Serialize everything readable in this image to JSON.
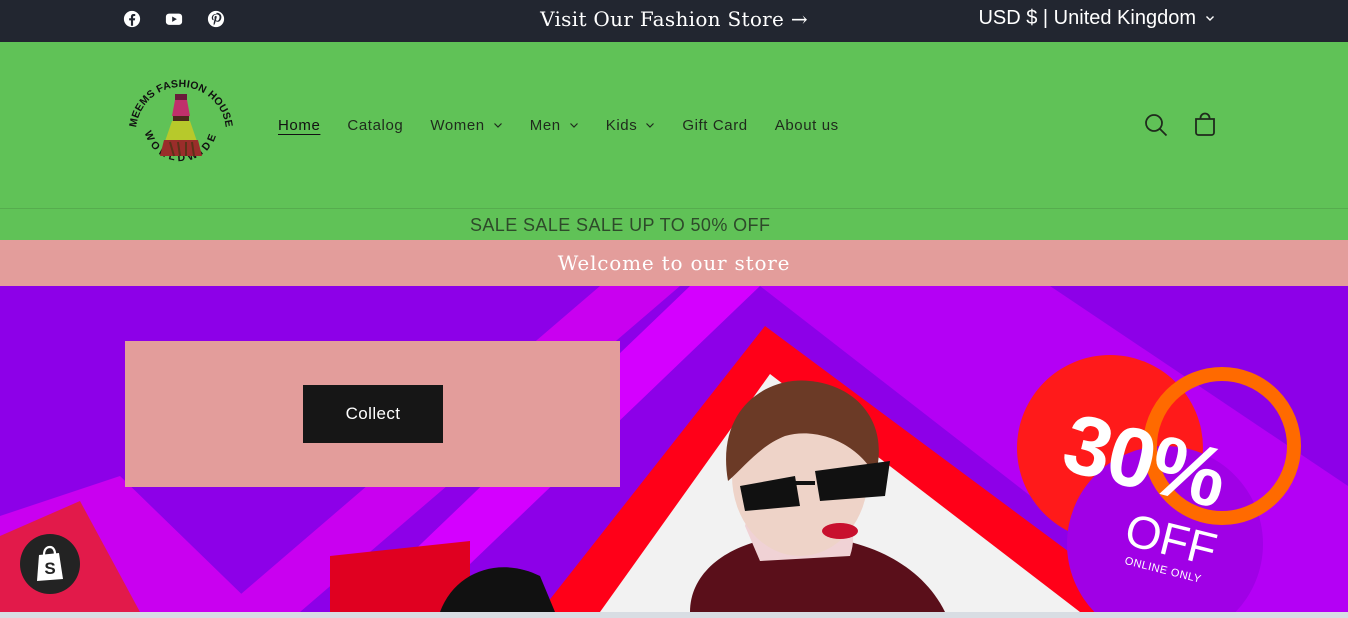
{
  "topbar": {
    "social": [
      {
        "name": "facebook-icon"
      },
      {
        "name": "youtube-icon"
      },
      {
        "name": "pinterest-icon"
      }
    ],
    "announcement": "Visit Our Fashion Store",
    "announcement_arrow": "→",
    "locale": "USD $ | United Kingdom"
  },
  "header": {
    "logo": {
      "arc_top": "MEEMS FASHION HOUSE",
      "arc_bottom": "WORLDWIDE"
    },
    "nav": [
      {
        "label": "Home",
        "active": true,
        "dropdown": false
      },
      {
        "label": "Catalog",
        "active": false,
        "dropdown": false
      },
      {
        "label": "Women",
        "active": false,
        "dropdown": true
      },
      {
        "label": "Men",
        "active": false,
        "dropdown": true
      },
      {
        "label": "Kids",
        "active": false,
        "dropdown": true
      },
      {
        "label": "Gift Card",
        "active": false,
        "dropdown": false
      },
      {
        "label": "About us",
        "active": false,
        "dropdown": false
      }
    ],
    "icons": [
      "search-icon",
      "cart-icon"
    ]
  },
  "sale_banner": "SALE SALE SALE UP TO 50% OFF",
  "welcome_banner": "Welcome to our store",
  "hero": {
    "button_label": "Collect",
    "promo": {
      "percent": "30%",
      "off": "OFF",
      "sub": "ONLINE ONLY"
    }
  },
  "colors": {
    "topbar": "#222630",
    "header": "#60c257",
    "welcome": "#e39d9b",
    "hero_bg": "#8d00e8",
    "button": "#161616"
  }
}
